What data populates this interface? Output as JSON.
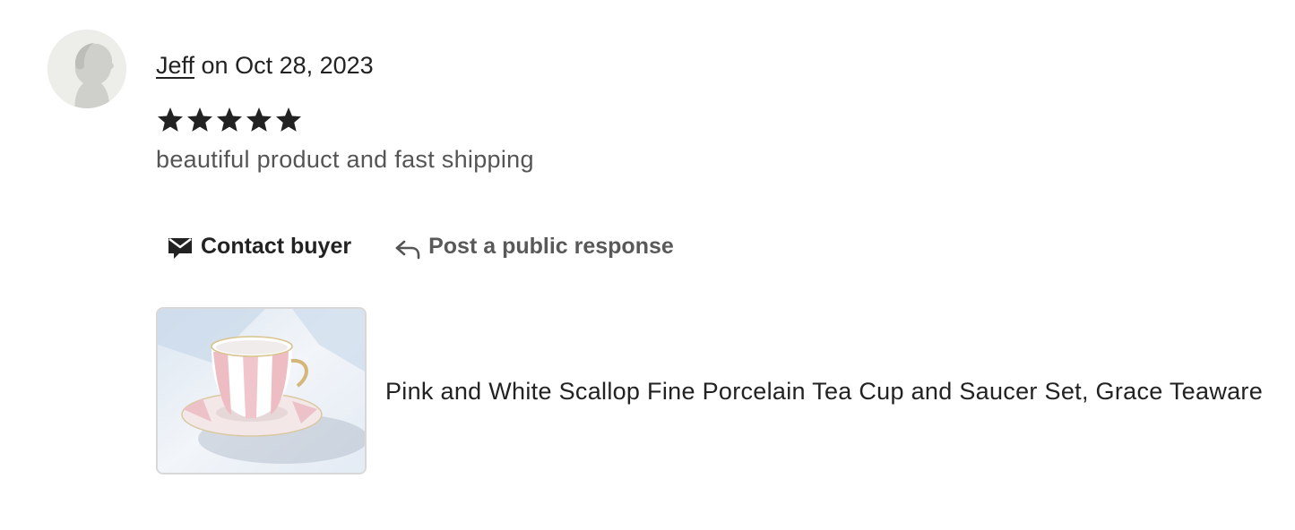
{
  "review": {
    "reviewer_name": "Jeff",
    "date_text": " on Oct 28, 2023",
    "rating": 5,
    "rating_max": 5,
    "text": "beautiful product and fast shipping"
  },
  "actions": {
    "contact_label": "Contact buyer",
    "respond_label": "Post a public response"
  },
  "product": {
    "title": "Pink and White Scallop Fine Porcelain Tea Cup and Saucer Set, Grace Teaware"
  },
  "icons": {
    "avatar": "person-silhouette-icon",
    "star": "star-icon",
    "contact": "envelope-icon",
    "respond": "reply-arrow-icon"
  },
  "colors": {
    "text_primary": "#222222",
    "text_secondary": "#555555",
    "avatar_bg": "#ededea",
    "thumb_border": "#d8d8d8"
  }
}
